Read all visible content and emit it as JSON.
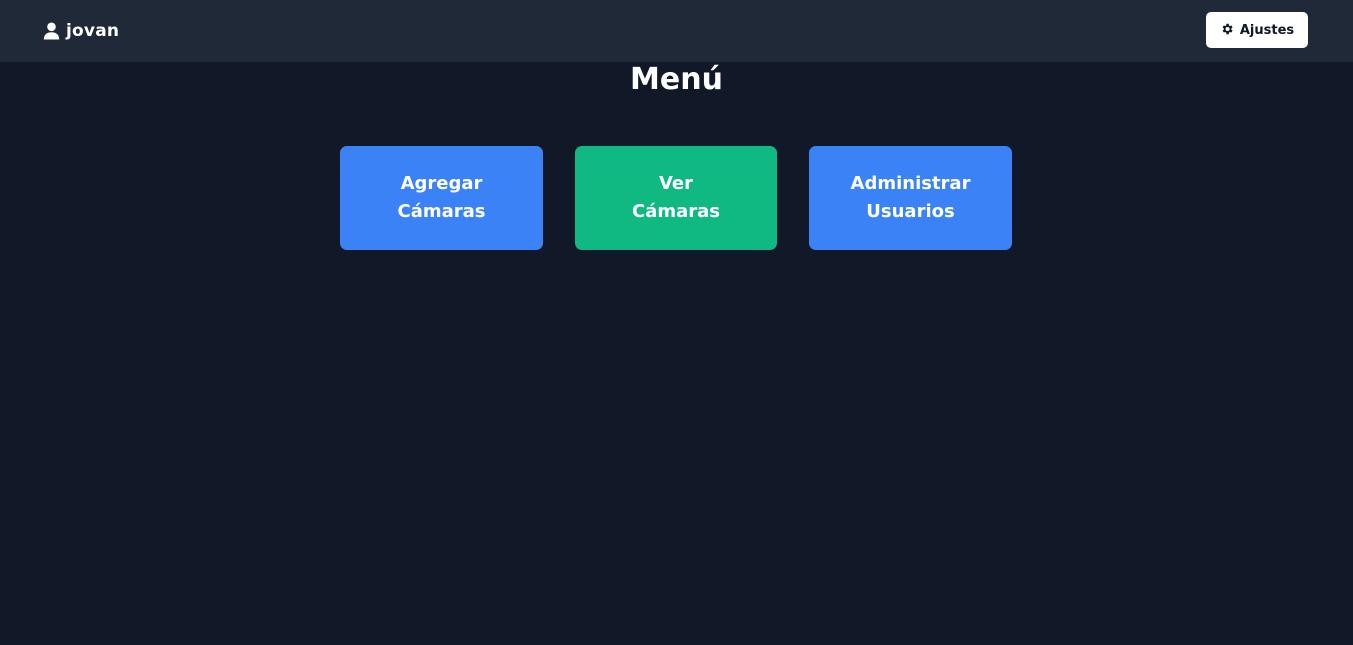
{
  "header": {
    "user_icon": "user-icon",
    "username": "jovan",
    "settings_icon": "gear-icon",
    "settings_label": "Ajustes"
  },
  "main": {
    "title": "Menú",
    "buttons": [
      {
        "line1": "Agregar",
        "line2": "Cámaras",
        "color": "#3b82f6"
      },
      {
        "line1": "Ver",
        "line2": "Cámaras",
        "color": "#10b981"
      },
      {
        "line1": "Administrar",
        "line2": "Usuarios",
        "color": "#3b82f6"
      }
    ]
  },
  "colors": {
    "background": "#111827",
    "topbar": "#1f2937",
    "primary": "#3b82f6",
    "success": "#10b981"
  }
}
